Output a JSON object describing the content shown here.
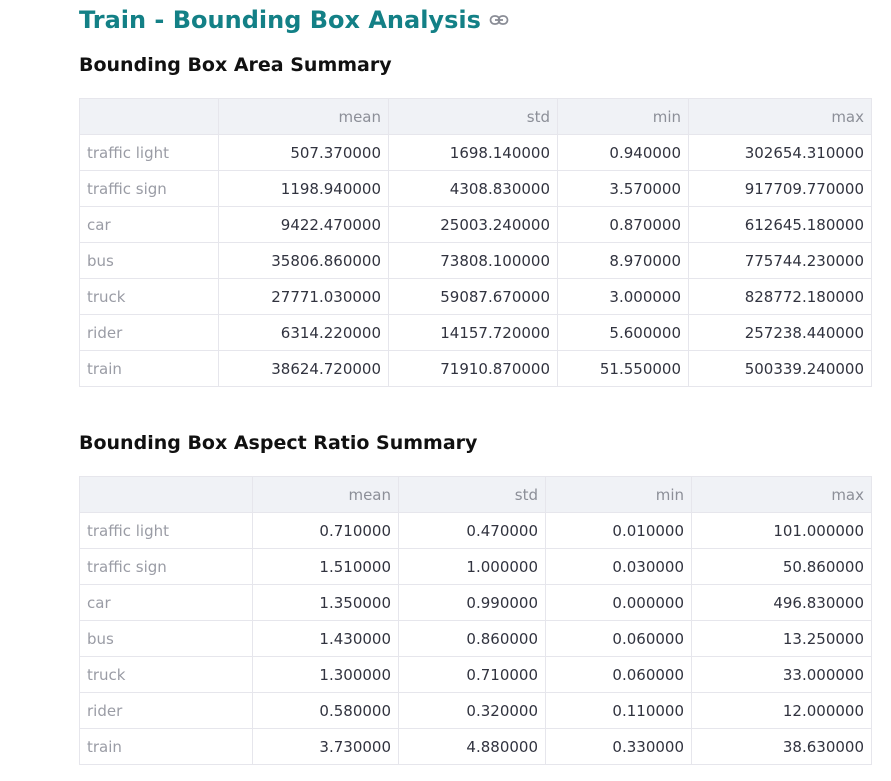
{
  "page": {
    "title": "Train - Bounding Box Analysis",
    "link_icon": "link-icon"
  },
  "area_section": {
    "title": "Bounding Box Area Summary",
    "columns": [
      "",
      "mean",
      "std",
      "min",
      "max"
    ],
    "rows": [
      {
        "label": "traffic light",
        "mean": "507.370000",
        "std": "1698.140000",
        "min": "0.940000",
        "max": "302654.310000"
      },
      {
        "label": "traffic sign",
        "mean": "1198.940000",
        "std": "4308.830000",
        "min": "3.570000",
        "max": "917709.770000"
      },
      {
        "label": "car",
        "mean": "9422.470000",
        "std": "25003.240000",
        "min": "0.870000",
        "max": "612645.180000"
      },
      {
        "label": "bus",
        "mean": "35806.860000",
        "std": "73808.100000",
        "min": "8.970000",
        "max": "775744.230000"
      },
      {
        "label": "truck",
        "mean": "27771.030000",
        "std": "59087.670000",
        "min": "3.000000",
        "max": "828772.180000"
      },
      {
        "label": "rider",
        "mean": "6314.220000",
        "std": "14157.720000",
        "min": "5.600000",
        "max": "257238.440000"
      },
      {
        "label": "train",
        "mean": "38624.720000",
        "std": "71910.870000",
        "min": "51.550000",
        "max": "500339.240000"
      }
    ]
  },
  "aspect_section": {
    "title": "Bounding Box Aspect Ratio Summary",
    "columns": [
      "",
      "mean",
      "std",
      "min",
      "max"
    ],
    "rows": [
      {
        "label": "traffic light",
        "mean": "0.710000",
        "std": "0.470000",
        "min": "0.010000",
        "max": "101.000000"
      },
      {
        "label": "traffic sign",
        "mean": "1.510000",
        "std": "1.000000",
        "min": "0.030000",
        "max": "50.860000"
      },
      {
        "label": "car",
        "mean": "1.350000",
        "std": "0.990000",
        "min": "0.000000",
        "max": "496.830000"
      },
      {
        "label": "bus",
        "mean": "1.430000",
        "std": "0.860000",
        "min": "0.060000",
        "max": "13.250000"
      },
      {
        "label": "truck",
        "mean": "1.300000",
        "std": "0.710000",
        "min": "0.060000",
        "max": "33.000000"
      },
      {
        "label": "rider",
        "mean": "0.580000",
        "std": "0.320000",
        "min": "0.110000",
        "max": "12.000000"
      },
      {
        "label": "train",
        "mean": "3.730000",
        "std": "4.880000",
        "min": "0.330000",
        "max": "38.630000"
      }
    ]
  }
}
